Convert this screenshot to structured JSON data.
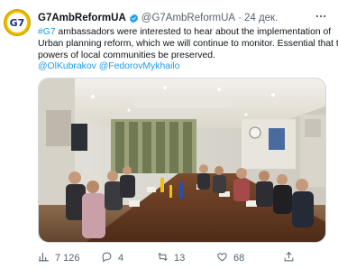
{
  "tweet": {
    "author_name": "G7AmbReformUA",
    "author_handle": "@G7AmbReformUA",
    "separator": "·",
    "date": "24 дек.",
    "avatar_label": "G7",
    "text": {
      "hashtag": "#G7",
      "line1_rest": " ambassadors were interested to hear about the implementation of",
      "line2": "Urban planning reform, which we will continue to monitor. Essential that the",
      "line3": "powers of local communities be preserved.",
      "mention1": "@OlKubrakov",
      "mention2": "@FedorovMykhailo"
    },
    "actions": {
      "views": "7 126",
      "replies": "4",
      "retweets": "13",
      "likes": "68"
    }
  },
  "colors": {
    "link": "#1d9bf0",
    "verified": "#1d9bf0",
    "secondary_text": "#536471"
  },
  "icons": {
    "views": "bar-chart-icon",
    "replies": "reply-icon",
    "retweets": "retweet-icon",
    "likes": "heart-icon",
    "share": "share-icon",
    "more": "more-icon",
    "verified": "verified-badge-icon"
  }
}
